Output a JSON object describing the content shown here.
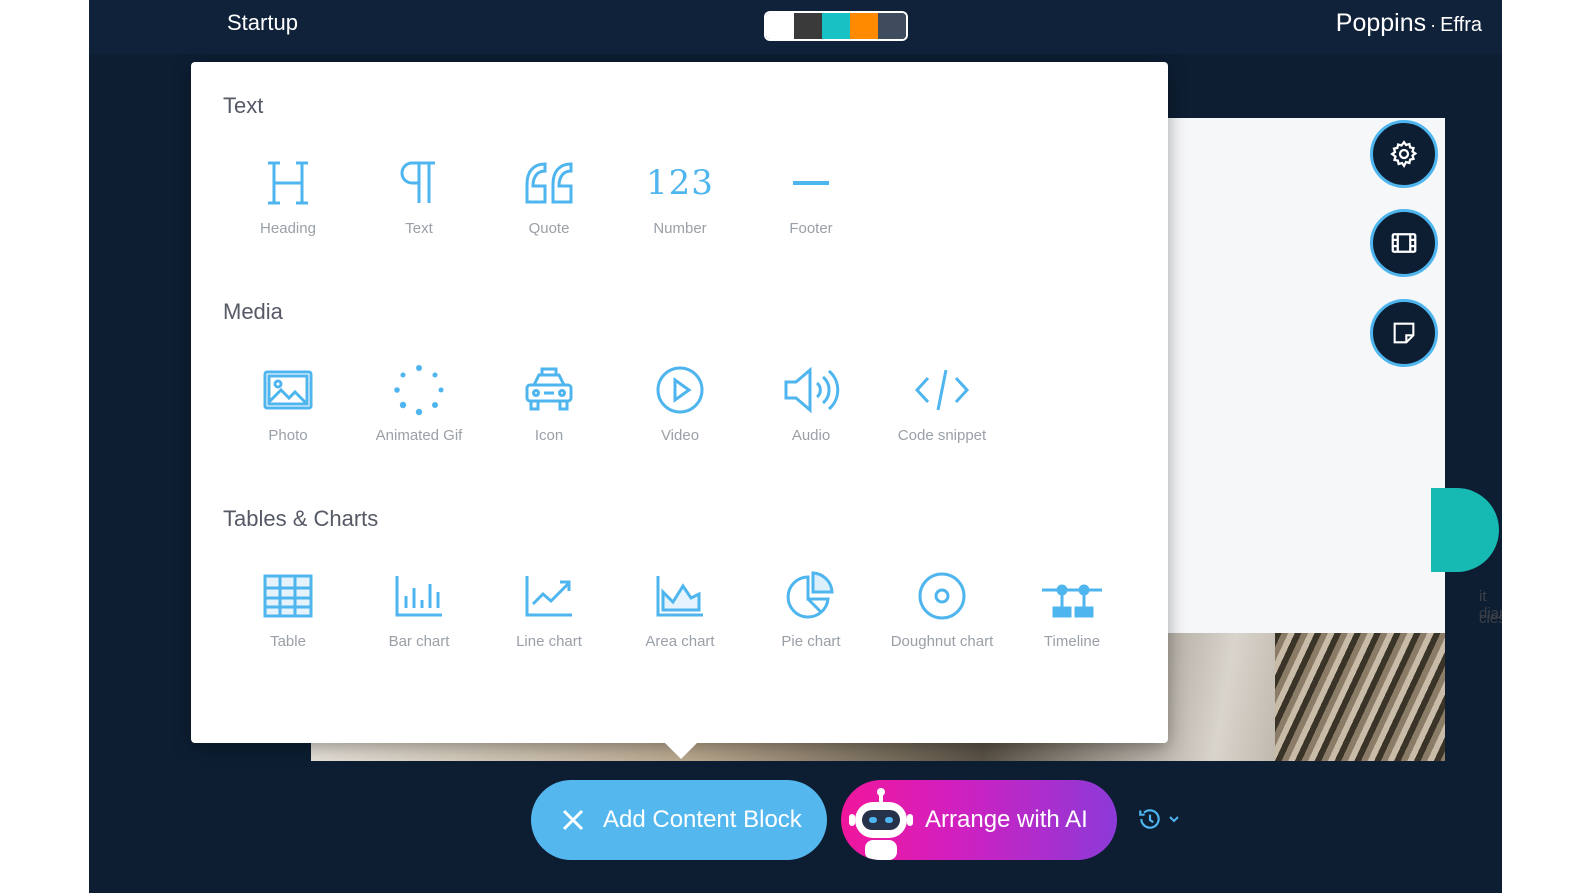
{
  "topbar": {
    "title": "Startup",
    "palette": [
      "#ffffff",
      "#3a3a3a",
      "#17c1c4",
      "#ff8a00",
      "#3e4c5e"
    ],
    "font_primary": "Poppins",
    "font_separator": "·",
    "font_secondary": "Effra"
  },
  "slide": {
    "text_line_1": "it diam",
    "text_line_2": "cies"
  },
  "panel": {
    "sections": [
      {
        "title": "Text",
        "items": [
          {
            "label": "Heading",
            "icon": "heading-icon"
          },
          {
            "label": "Text",
            "icon": "paragraph-icon"
          },
          {
            "label": "Quote",
            "icon": "quote-icon"
          },
          {
            "label": "Number",
            "icon": "number-icon",
            "glyph": "123"
          },
          {
            "label": "Footer",
            "icon": "footer-icon"
          }
        ]
      },
      {
        "title": "Media",
        "items": [
          {
            "label": "Photo",
            "icon": "photo-icon"
          },
          {
            "label": "Animated Gif",
            "icon": "spinner-icon"
          },
          {
            "label": "Icon",
            "icon": "taxi-icon"
          },
          {
            "label": "Video",
            "icon": "play-icon"
          },
          {
            "label": "Audio",
            "icon": "speaker-icon"
          },
          {
            "label": "Code snippet",
            "icon": "code-icon"
          }
        ]
      },
      {
        "title": "Tables & Charts",
        "items": [
          {
            "label": "Table",
            "icon": "table-icon"
          },
          {
            "label": "Bar chart",
            "icon": "bar-chart-icon"
          },
          {
            "label": "Line chart",
            "icon": "line-chart-icon"
          },
          {
            "label": "Area chart",
            "icon": "area-chart-icon"
          },
          {
            "label": "Pie chart",
            "icon": "pie-chart-icon"
          },
          {
            "label": "Doughnut chart",
            "icon": "doughnut-chart-icon"
          },
          {
            "label": "Timeline",
            "icon": "timeline-icon"
          }
        ]
      }
    ]
  },
  "side_tools": [
    {
      "icon": "gear-icon"
    },
    {
      "icon": "film-icon"
    },
    {
      "icon": "sticky-note-icon"
    }
  ],
  "bottom": {
    "add_label": "Add Content Block",
    "ai_label": "Arrange with AI",
    "history_icon": "history-icon"
  },
  "colors": {
    "accent": "#54b8ef",
    "icon_blue": "#4eb5ee",
    "background": "#0d1e33"
  }
}
